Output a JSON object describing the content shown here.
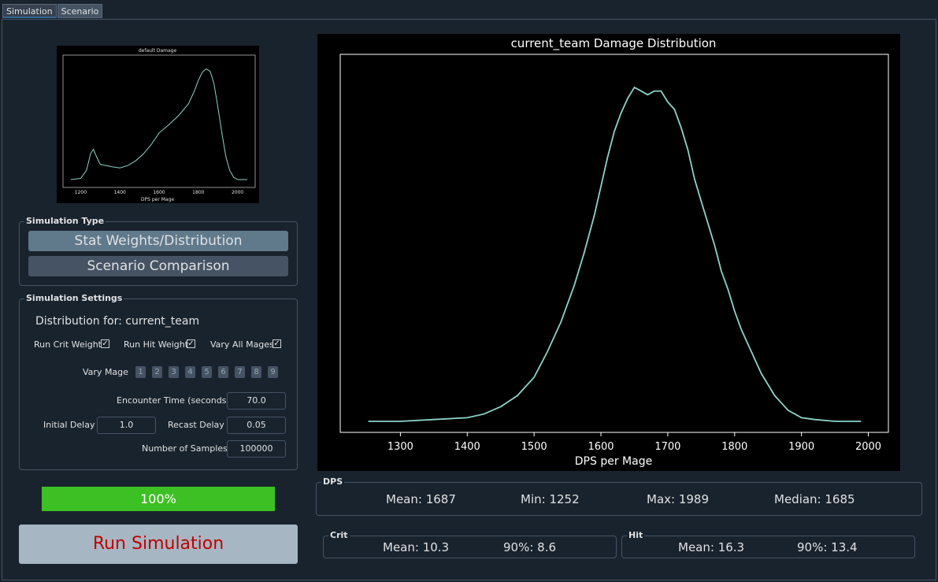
{
  "tabs": [
    {
      "label": "Simulation"
    },
    {
      "label": "Scenario"
    }
  ],
  "thumbnail": {
    "title": "default Damage",
    "xlabel": "DPS per Mage",
    "ticks": [
      "1200",
      "1400",
      "1600",
      "1800",
      "2000"
    ],
    "x": [
      1150,
      1200,
      1230,
      1250,
      1265,
      1280,
      1300,
      1330,
      1360,
      1400,
      1440,
      1480,
      1520,
      1560,
      1600,
      1650,
      1700,
      1750,
      1780,
      1800,
      1820,
      1840,
      1860,
      1870,
      1880,
      1900,
      1920,
      1940,
      1960,
      1980,
      2000,
      2050
    ],
    "y": [
      0.0,
      0.01,
      0.08,
      0.22,
      0.26,
      0.2,
      0.13,
      0.12,
      0.11,
      0.1,
      0.12,
      0.16,
      0.22,
      0.3,
      0.4,
      0.47,
      0.55,
      0.65,
      0.76,
      0.85,
      0.92,
      0.95,
      0.93,
      0.88,
      0.82,
      0.62,
      0.4,
      0.2,
      0.08,
      0.02,
      0.0,
      0.0
    ]
  },
  "simulation_type": {
    "title": "Simulation Type",
    "stat_weights_button": "Stat Weights/Distribution",
    "scenario_comparison_button": "Scenario Comparison"
  },
  "simulation_settings": {
    "title": "Simulation Settings",
    "distribution_for": "Distribution for: current_team",
    "run_crit_weight": {
      "label": "Run Crit Weight",
      "checked": true
    },
    "run_hit_weight": {
      "label": "Run Hit Weight",
      "checked": true
    },
    "vary_all_mages": {
      "label": "Vary All Mages",
      "checked": true
    },
    "vary_mage_label": "Vary Mage",
    "mages": [
      "1",
      "2",
      "3",
      "4",
      "5",
      "6",
      "7",
      "8",
      "9"
    ],
    "encounter_time_label": "Encounter Time (seconds):",
    "encounter_time_value": "70.0",
    "initial_delay_label": "Initial Delay",
    "initial_delay_value": "1.0",
    "recast_delay_label": "Recast Delay",
    "recast_delay_value": "0.05",
    "samples_label": "Number of Samples:",
    "samples_value": "100000"
  },
  "progress": {
    "value": 1.0,
    "label": "100%",
    "color": "#3dc024"
  },
  "run_button": {
    "label": "Run Simulation",
    "color": "#c00000"
  },
  "chart_data": {
    "type": "line",
    "title": "current_team Damage Distribution",
    "xlabel": "DPS per Mage",
    "ylabel": "",
    "xlim": [
      1210,
      2030
    ],
    "ylim": [
      -0.03,
      1.0
    ],
    "xticks": [
      1300,
      1400,
      1500,
      1600,
      1700,
      1800,
      1900,
      2000
    ],
    "series": [
      {
        "color": "#8dd3c7",
        "x": [
          1252,
          1300,
          1350,
          1400,
          1425,
          1450,
          1475,
          1500,
          1520,
          1540,
          1560,
          1575,
          1590,
          1600,
          1610,
          1620,
          1630,
          1640,
          1650,
          1660,
          1670,
          1680,
          1690,
          1700,
          1710,
          1720,
          1730,
          1740,
          1750,
          1760,
          1770,
          1780,
          1790,
          1800,
          1810,
          1820,
          1830,
          1840,
          1850,
          1860,
          1870,
          1880,
          1890,
          1900,
          1920,
          1950,
          1989
        ],
        "y": [
          0.0,
          0.0,
          0.005,
          0.01,
          0.02,
          0.04,
          0.07,
          0.12,
          0.19,
          0.27,
          0.37,
          0.46,
          0.56,
          0.64,
          0.72,
          0.79,
          0.84,
          0.88,
          0.91,
          0.9,
          0.89,
          0.9,
          0.9,
          0.87,
          0.85,
          0.8,
          0.74,
          0.66,
          0.6,
          0.54,
          0.48,
          0.41,
          0.36,
          0.3,
          0.25,
          0.21,
          0.17,
          0.13,
          0.1,
          0.07,
          0.05,
          0.03,
          0.02,
          0.01,
          0.005,
          0.0,
          0.0
        ]
      }
    ]
  },
  "dps": {
    "title": "DPS",
    "mean": "Mean: 1687",
    "min": "Min: 1252",
    "max": "Max: 1989",
    "median": "Median: 1685"
  },
  "crit": {
    "title": "Crit",
    "mean": "Mean: 10.3",
    "p90": "90%: 8.6"
  },
  "hit": {
    "title": "Hit",
    "mean": "Mean: 16.3",
    "p90": "90%: 13.4"
  }
}
